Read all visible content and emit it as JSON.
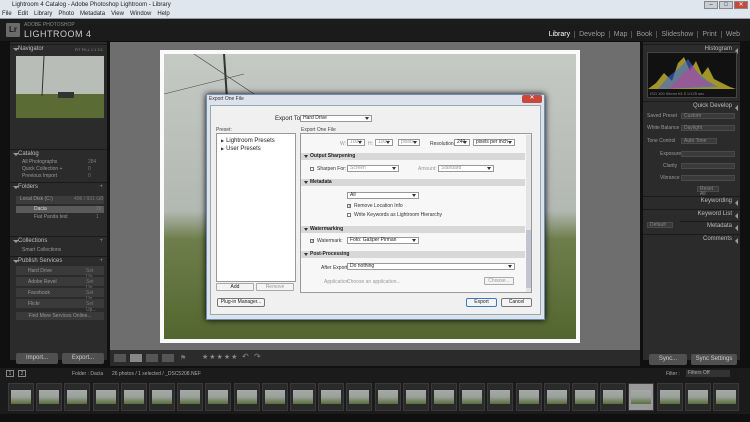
{
  "window": {
    "title": "Lightroom 4 Catalog - Adobe Photoshop Lightroom - Library",
    "buttons": [
      "–",
      "□",
      "✕"
    ]
  },
  "menu": [
    "File",
    "Edit",
    "Library",
    "Photo",
    "Metadata",
    "View",
    "Window",
    "Help"
  ],
  "identity": {
    "logo": "Lr",
    "adobe": "ADOBE PHOTOSHOP",
    "product": "LIGHTROOM 4"
  },
  "modules": [
    "Library",
    "Develop",
    "Map",
    "Book",
    "Slideshow",
    "Print",
    "Web"
  ],
  "left": {
    "navigator": {
      "title": "Navigator",
      "zoom": "FIT FILL 1:1 3:1"
    },
    "catalog": {
      "title": "Catalog",
      "items": [
        {
          "label": "All Photographs",
          "count": "284"
        },
        {
          "label": "Quick Collection +",
          "count": "0"
        },
        {
          "label": "Previous Import",
          "count": "0"
        }
      ]
    },
    "folders": {
      "title": "Folders",
      "volume": "Local Disk (C:)",
      "volume_info": "406 / 931 GB",
      "items": [
        {
          "label": "Dacia",
          "count": "26"
        },
        {
          "label": "Fiat Panda test",
          "count": "1"
        }
      ]
    },
    "collections": {
      "title": "Collections",
      "items": [
        "Smart Collections"
      ]
    },
    "publish": {
      "title": "Publish Services",
      "items": [
        {
          "label": "Hard Drive",
          "action": "Set Up..."
        },
        {
          "label": "Adobe Revel",
          "action": "Set Up..."
        },
        {
          "label": "Facebook",
          "action": "Set Up..."
        },
        {
          "label": "Flickr",
          "action": "Set Up..."
        }
      ],
      "more": "Find More Services Online..."
    },
    "import_btn": "Import...",
    "export_btn": "Export..."
  },
  "right": {
    "histogram": {
      "title": "Histogram",
      "readout": "ISO 100   50mm   f/4.5   1/125 sec"
    },
    "quick_develop": {
      "title": "Quick Develop",
      "saved_preset_label": "Saved Preset",
      "saved_preset_value": "Custom",
      "wb_label": "White Balance",
      "wb_value": "Daylight",
      "tone_label": "Tone Control",
      "tone_value": "Auto Tone",
      "rows": [
        "Exposure",
        "Clarity",
        "Vibrance"
      ],
      "reset": "Reset All"
    },
    "keywording": "Keywording",
    "keyword_list": "Keyword List",
    "metadata": "Metadata",
    "metadata_preset": "Default",
    "comments": "Comments",
    "sync_btn": "Sync...",
    "sync_settings_btn": "Sync Settings"
  },
  "toolbar": {
    "stars": "★★★★★"
  },
  "filmstrip": {
    "pages": [
      "1",
      "2"
    ],
    "source": "Folder : Dacia",
    "count": "26 photos / 1 selected / _DSC5208.NEF",
    "filter_label": "Filter :",
    "filter_value": "Filters Off"
  },
  "dialog": {
    "title": "Export One File",
    "export_to_label": "Export To:",
    "export_to_value": "Hard Drive",
    "preset_label": "Preset:",
    "settings_label": "Export One File",
    "presets": [
      "Lightroom Presets",
      "User Presets"
    ],
    "add_btn": "Add",
    "remove_btn": "Remove",
    "image_sizing": {
      "w_label": "W:",
      "w_value": "1000",
      "h_label": "H:",
      "h_value": "1000",
      "unit": "pixels",
      "res_label": "Resolution:",
      "res_value": "240",
      "res_unit": "pixels per inch"
    },
    "output_sharpening": {
      "title": "Output Sharpening",
      "sharpen_label": "Sharpen For:",
      "sharpen_value": "Screen",
      "amount_label": "Amount:",
      "amount_value": "Standard"
    },
    "metadata": {
      "title": "Metadata",
      "value": "All",
      "remove_location": "Remove Location Info",
      "write_keywords": "Write Keywords as Lightroom Hierarchy"
    },
    "watermarking": {
      "title": "Watermarking",
      "label": "Watermark:",
      "value": "Foto: Gašper Pirman"
    },
    "post_processing": {
      "title": "Post-Processing",
      "after_label": "After Export:",
      "after_value": "Do nothing",
      "app_label": "Application:",
      "app_placeholder": "Choose an application...",
      "choose_btn": "Choose..."
    },
    "plugin_btn": "Plug-in Manager...",
    "export_btn": "Export",
    "cancel_btn": "Cancel"
  }
}
